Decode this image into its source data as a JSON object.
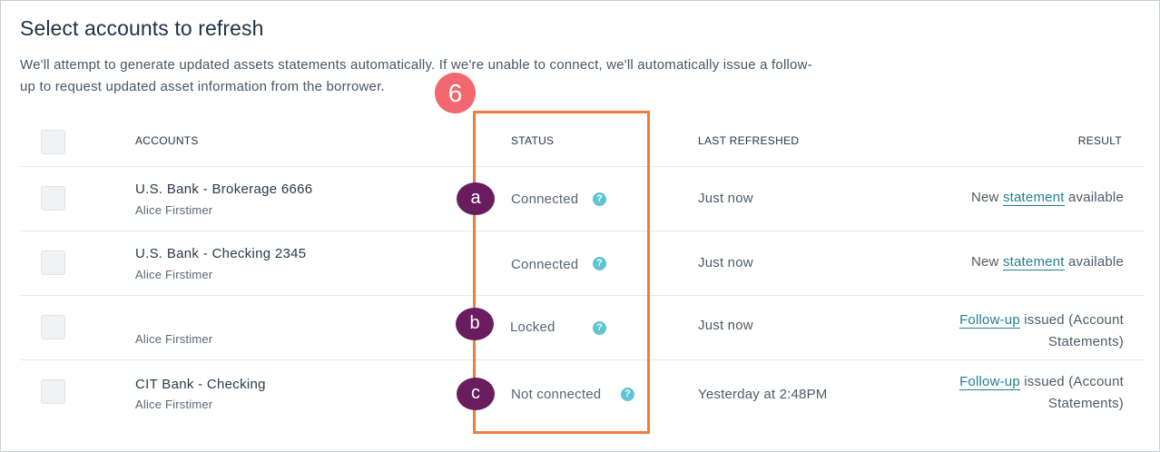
{
  "page": {
    "title": "Select accounts to refresh",
    "description": "We'll attempt to generate updated assets statements automatically. If we're unable to connect, we'll automatically issue a follow-up to request updated asset information from the borrower."
  },
  "table": {
    "headers": {
      "accounts": "ACCOUNTS",
      "status": "STATUS",
      "last_refreshed": "LAST REFRESHED",
      "result": "RESULT"
    },
    "rows": [
      {
        "account": "U.S. Bank - Brokerage 6666",
        "owner": "Alice Firstimer",
        "status": "Connected",
        "last_refreshed": "Just now",
        "result_prefix": "New",
        "result_link": "statement",
        "result_suffix": "available",
        "result_line2": ""
      },
      {
        "account": "U.S. Bank - Checking 2345",
        "owner": "Alice Firstimer",
        "status": "Connected",
        "last_refreshed": "Just now",
        "result_prefix": "New",
        "result_link": "statement",
        "result_suffix": "available",
        "result_line2": ""
      },
      {
        "account": "",
        "owner": "Alice Firstimer",
        "status": "Locked",
        "last_refreshed": "Just now",
        "result_prefix": "",
        "result_link": "Follow-up",
        "result_suffix": "issued (Account",
        "result_line2": "Statements)"
      },
      {
        "account": "CIT Bank - Checking",
        "owner": "Alice Firstimer",
        "status": "Not connected",
        "last_refreshed": "Yesterday at 2:48PM",
        "result_prefix": "",
        "result_link": "Follow-up",
        "result_suffix": "issued (Account",
        "result_line2": "Statements)"
      }
    ]
  },
  "annotations": {
    "step_number": "6",
    "callouts": [
      "a",
      "b",
      "c"
    ],
    "highlight_color": "#f07d3c",
    "step_color": "#f3686e",
    "callout_color": "#6a1d5e"
  },
  "icons": {
    "help": "question-mark-icon",
    "help_glyph": "?"
  },
  "colors": {
    "link": "#217f95",
    "help_icon": "#5fc4d2"
  }
}
